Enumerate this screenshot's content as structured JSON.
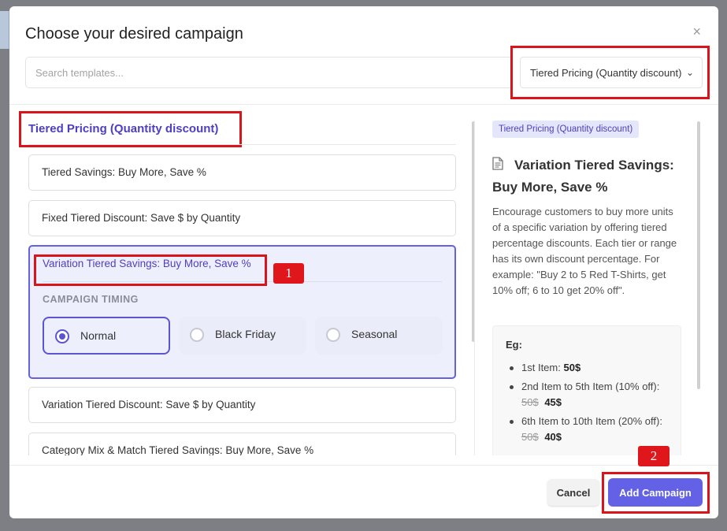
{
  "modal": {
    "title": "Choose your desired campaign",
    "close_symbol": "×"
  },
  "search": {
    "placeholder": "Search templates..."
  },
  "category_select": {
    "selected": "Tiered Pricing (Quantity discount)",
    "chevron": "⌄"
  },
  "left": {
    "section_title": "Tiered Pricing (Quantity discount)",
    "items": [
      "Tiered Savings: Buy More, Save %",
      "Fixed Tiered Discount: Save $ by Quantity",
      "Variation Tiered Savings: Buy More, Save %",
      "Variation Tiered Discount: Save $ by Quantity",
      "Category Mix & Match Tiered Savings: Buy More, Save %"
    ],
    "timing_label": "CAMPAIGN TIMING",
    "timing_options": [
      "Normal",
      "Black Friday",
      "Seasonal"
    ],
    "timing_selected": "Normal"
  },
  "annotations": {
    "marker_1": "1",
    "marker_2": "2",
    "highlight_color": "#d9141b"
  },
  "preview": {
    "tag": "Tiered Pricing (Quantity discount)",
    "title": "Variation Tiered Savings: Buy More, Save %",
    "description": "Encourage customers to buy more units of a specific variation by offering tiered percentage discounts. Each tier or range has its own discount percentage. For example: \"Buy 2 to 5 Red T-Shirts, get 10% off; 6 to 10 get 20% off\".",
    "eg_title": "Eg:",
    "examples": [
      {
        "label": "1st Item:",
        "old": "",
        "price": "50$"
      },
      {
        "label": "2nd Item to 5th Item (10% off):",
        "old": "50$",
        "price": "45$"
      },
      {
        "label": "6th Item to 10th Item (20% off):",
        "old": "50$",
        "price": "40$"
      }
    ]
  },
  "footer": {
    "cancel_label": "Cancel",
    "add_label": "Add Campaign"
  },
  "colors": {
    "accent": "#6362e6",
    "accent_text": "#4d3fc1",
    "highlight": "#d9141b"
  }
}
